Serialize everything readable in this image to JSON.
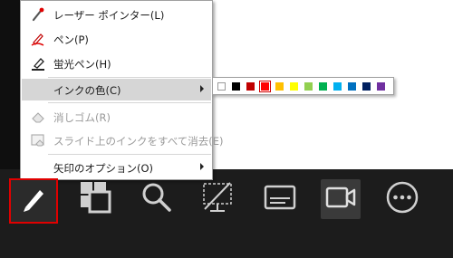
{
  "menu": {
    "items": [
      {
        "label": "レーザー ポインター(L)",
        "icon": "laser-pointer-icon",
        "enabled": true
      },
      {
        "label": "ペン(P)",
        "icon": "pen-icon",
        "enabled": true
      },
      {
        "label": "蛍光ペン(H)",
        "icon": "highlighter-icon",
        "enabled": true
      },
      {
        "label": "インクの色(C)",
        "icon": "",
        "enabled": true,
        "submenu": true,
        "highlighted": true
      },
      {
        "label": "消しゴム(R)",
        "icon": "eraser-icon",
        "enabled": false
      },
      {
        "label": "スライド上のインクをすべて消去(E)",
        "icon": "erase-all-ink-icon",
        "enabled": false
      },
      {
        "label": "矢印のオプション(O)",
        "icon": "",
        "enabled": true,
        "submenu": true
      }
    ]
  },
  "ink_colors": {
    "swatches": [
      "#ffffff",
      "#000000",
      "#c00000",
      "#ff0000",
      "#ffc000",
      "#ffff00",
      "#92d050",
      "#00b050",
      "#00b0f0",
      "#0070c0",
      "#002060",
      "#7030a0"
    ],
    "selected_index": 3
  },
  "toolbar": {
    "buttons": [
      {
        "icon": "pen-icon",
        "active": true
      },
      {
        "icon": "slides-grid-icon",
        "active": false
      },
      {
        "icon": "zoom-icon",
        "active": false
      },
      {
        "icon": "pointer-display-icon",
        "active": false
      },
      {
        "icon": "subtitles-icon",
        "active": false
      },
      {
        "icon": "camera-icon",
        "active": false
      },
      {
        "icon": "more-options-icon",
        "active": false
      }
    ]
  }
}
